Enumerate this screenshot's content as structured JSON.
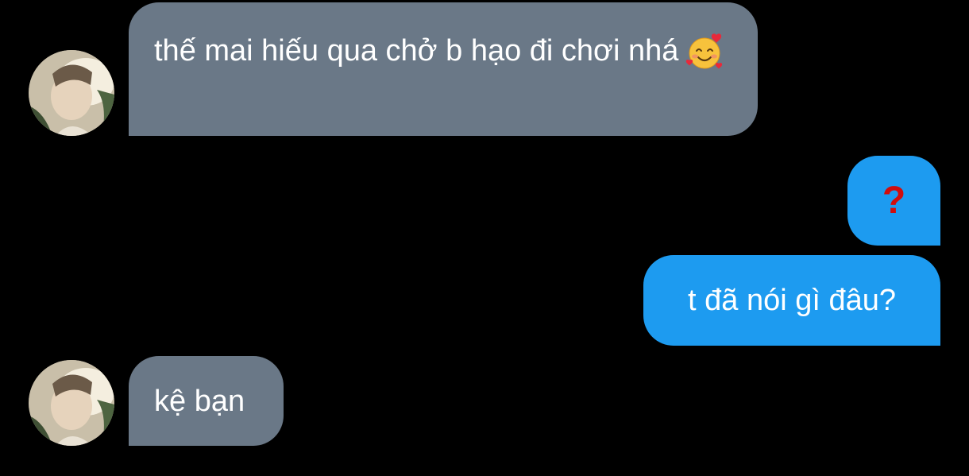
{
  "messages": [
    {
      "side": "incoming",
      "text": "thế mai hiếu qua chở b hạo đi chơi nhá",
      "emoji": "smiling-face-with-hearts"
    },
    {
      "side": "outgoing",
      "text": "?"
    },
    {
      "side": "outgoing",
      "text": "t đã nói gì đâu?"
    },
    {
      "side": "incoming",
      "text": "kệ bạn"
    }
  ],
  "colors": {
    "background": "#000000",
    "incoming_bubble": "#6a7887",
    "outgoing_bubble": "#1d9bf0",
    "question_mark": "#d10d0d",
    "text": "#ffffff"
  }
}
